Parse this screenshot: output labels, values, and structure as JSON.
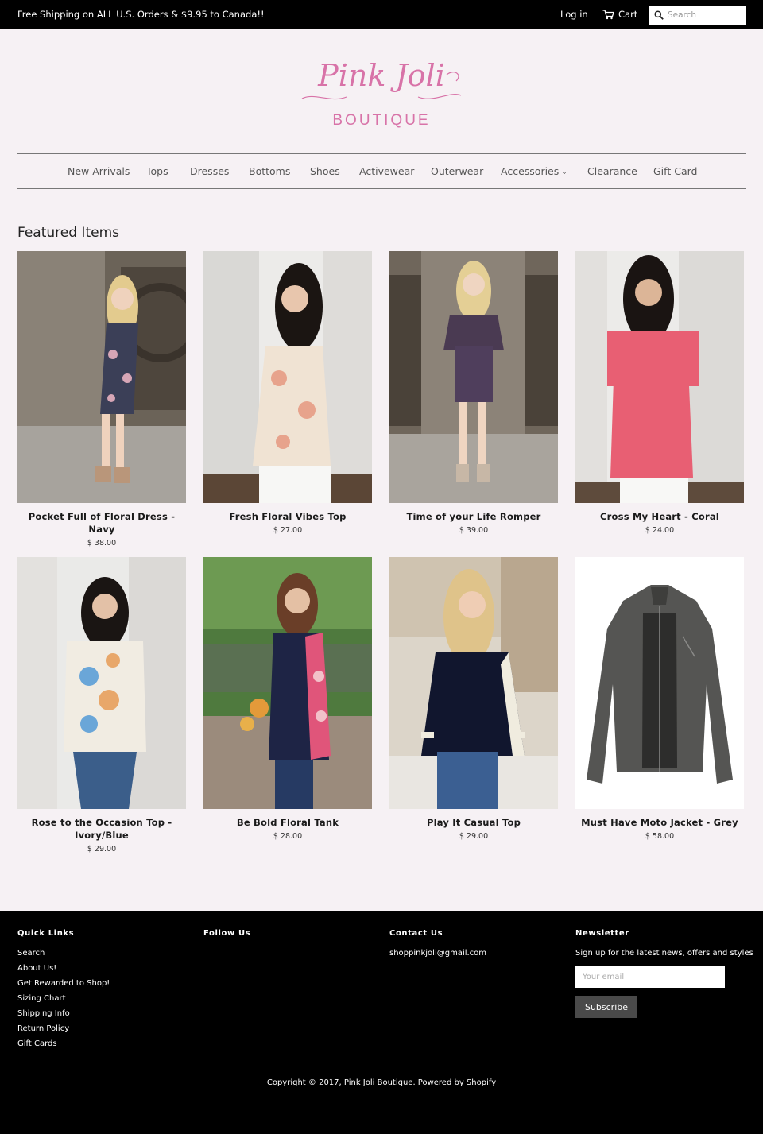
{
  "topbar": {
    "announcement": "Free Shipping on ALL U.S. Orders & $9.95 to Canada!!",
    "login": "Log in",
    "cart": "Cart",
    "search_placeholder": "Search"
  },
  "logo": {
    "script": "Pink Joli",
    "word": "BOUTIQUE",
    "color": "#d873a8"
  },
  "nav": {
    "items": [
      "New Arrivals",
      "Tops",
      "Dresses",
      "Bottoms",
      "Shoes",
      "Activewear",
      "Outerwear",
      "Accessories",
      "Clearance",
      "Gift Card"
    ]
  },
  "featured": {
    "title": "Featured Items",
    "products": [
      {
        "title": "Pocket Full of Floral Dress - Navy",
        "price": "$ 38.00"
      },
      {
        "title": "Fresh Floral Vibes Top",
        "price": "$ 27.00"
      },
      {
        "title": "Time of your Life Romper",
        "price": "$ 39.00"
      },
      {
        "title": "Cross My Heart - Coral",
        "price": "$ 24.00"
      },
      {
        "title": "Rose to the Occasion Top - Ivory/Blue",
        "price": "$ 29.00"
      },
      {
        "title": "Be Bold Floral Tank",
        "price": "$ 28.00"
      },
      {
        "title": "Play It Casual Top",
        "price": "$ 29.00"
      },
      {
        "title": "Must Have Moto Jacket - Grey",
        "price": "$ 58.00"
      }
    ]
  },
  "footer": {
    "quick_links": {
      "heading": "Quick Links",
      "links": [
        "Search",
        "About Us!",
        "Get Rewarded to Shop!",
        "Sizing Chart",
        "Shipping Info",
        "Return Policy",
        "Gift Cards"
      ]
    },
    "follow": {
      "heading": "Follow Us"
    },
    "contact": {
      "heading": "Contact Us",
      "email": "shoppinkjoli@gmail.com"
    },
    "newsletter": {
      "heading": "Newsletter",
      "text": "Sign up for the latest news, offers and styles",
      "placeholder": "Your email",
      "button": "Subscribe"
    },
    "copyright": "Copyright © 2017, Pink Joli Boutique. Powered by Shopify"
  }
}
